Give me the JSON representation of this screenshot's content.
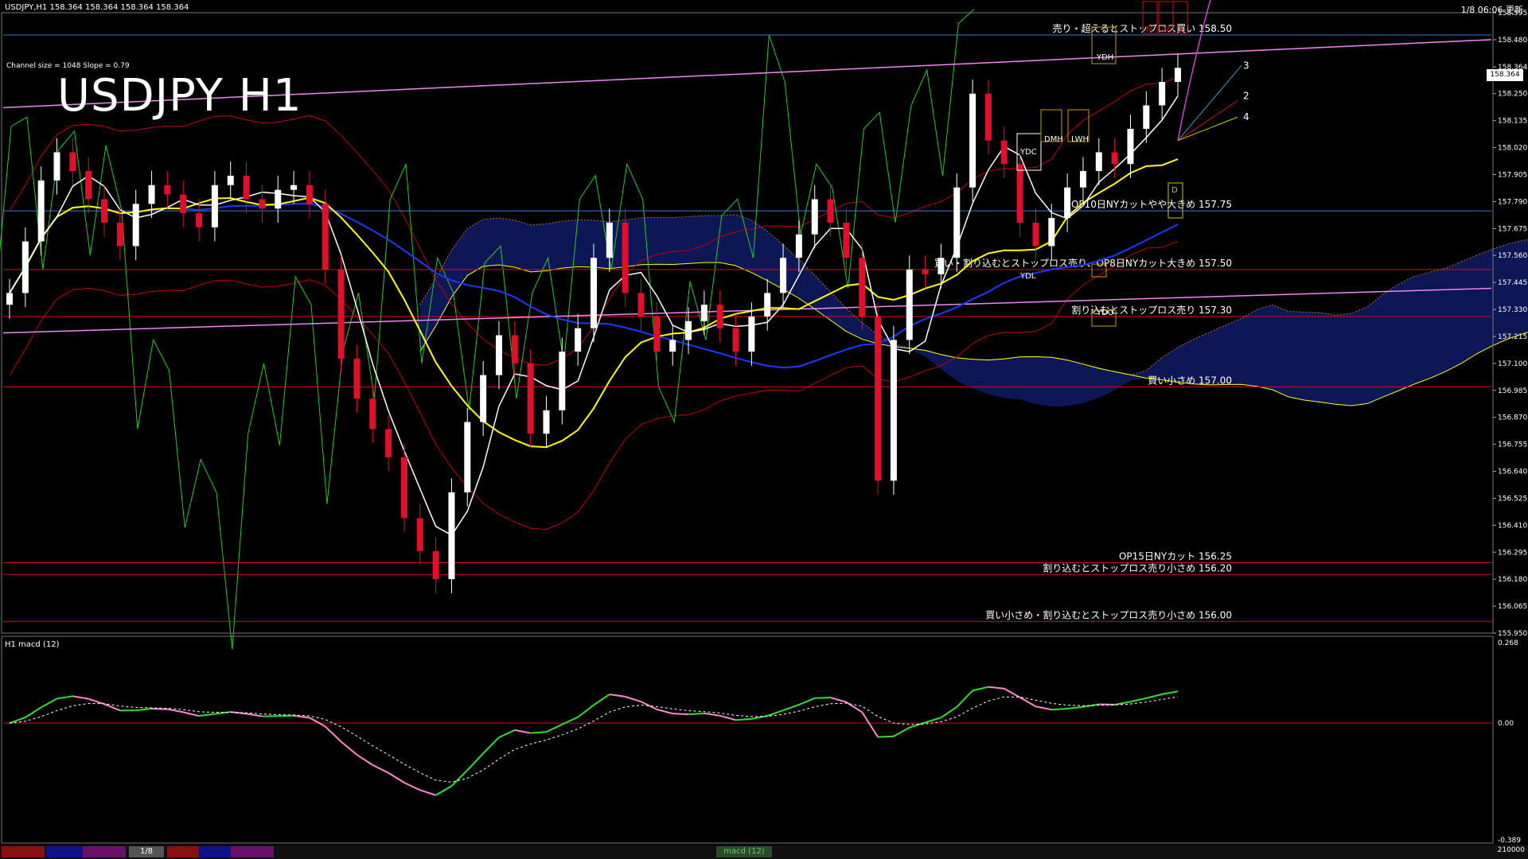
{
  "window": {
    "symbol_line": "USDJPY,H1  158.364 158.364 158.364 158.364",
    "clock": "1/8 06:06 更新"
  },
  "title": "USDJPY H1",
  "channel_info": "Channel size = 1048 Slope = 0.79",
  "macd_title": "H1  macd (12)",
  "current_price": "158.364",
  "colors": {
    "bg": "#000000",
    "bull": "#ffffff",
    "bear": "#e0102a",
    "ma_fast": "#ffffff",
    "ma_mid": "#ffff00",
    "ma_slow": "#1a3aff",
    "bollinger": "#c00000",
    "chikou": "#22cc22",
    "cloud_blue": "#1a2a9a",
    "cloud_orange": "#b07040",
    "level_red": "#d01010",
    "level_blue": "#3a7acd",
    "trend_pink": "#ee88ee",
    "macd_up": "#33dd33",
    "macd_down": "#ff88cc"
  },
  "chart_data": {
    "type": "candlestick",
    "ylim": [
      155.95,
      158.595
    ],
    "y_ticks": [
      "158.595",
      "158.480",
      "158.364",
      "158.250",
      "158.135",
      "158.020",
      "157.905",
      "157.790",
      "157.675",
      "157.560",
      "157.445",
      "157.330",
      "157.215",
      "157.100",
      "156.985",
      "156.870",
      "156.755",
      "156.640",
      "156.525",
      "156.410",
      "156.295",
      "156.180",
      "156.065",
      "155.950"
    ],
    "closes": [
      157.4,
      157.62,
      157.88,
      158.0,
      157.92,
      157.8,
      157.7,
      157.6,
      157.78,
      157.86,
      157.82,
      157.74,
      157.68,
      157.86,
      157.9,
      157.8,
      157.76,
      157.84,
      157.86,
      157.78,
      157.5,
      157.12,
      156.95,
      156.82,
      156.7,
      156.44,
      156.3,
      156.18,
      156.55,
      156.85,
      157.05,
      157.22,
      157.1,
      156.8,
      156.9,
      157.15,
      157.25,
      157.55,
      157.7,
      157.4,
      157.3,
      157.15,
      157.2,
      157.28,
      157.35,
      157.25,
      157.15,
      157.3,
      157.4,
      157.55,
      157.65,
      157.8,
      157.7,
      157.55,
      157.3,
      156.6,
      157.2,
      157.5,
      157.48,
      157.55,
      157.85,
      158.25,
      158.05,
      157.95,
      157.7,
      157.6,
      157.72,
      157.85,
      157.92,
      158.0,
      157.95,
      158.1,
      158.2,
      158.3,
      158.36
    ],
    "macd_ylim": [
      -0.389,
      0.268
    ],
    "macd_ticks": [
      "0.268",
      "0.00",
      "-0.389"
    ],
    "levels": [
      {
        "label": "売り・超えるとストップロス買い 158.50",
        "price": 158.5,
        "color": "#3a7acd"
      },
      {
        "label": "OP10日NYカットやや大きめ 157.75",
        "price": 157.75,
        "color": "#3a7acd"
      },
      {
        "label": "買い・割り込むとストップロス売り、OP8日NYカット大きめ 157.50",
        "price": 157.5,
        "color": "#d01010"
      },
      {
        "label": "割り込むとストップロス売り 157.30",
        "price": 157.3,
        "color": "#d01010"
      },
      {
        "label": "買い小さめ 157.00",
        "price": 157.0,
        "color": "#d01010"
      },
      {
        "label": "OP15日NYカット 156.25",
        "price": 156.25,
        "color": "#d01010"
      },
      {
        "label": "割り込むとストップロス売り小さめ 156.20",
        "price": 156.2,
        "color": "#d01010"
      },
      {
        "label": "買い小さめ・割り込むとストップロス売り小さめ 156.00",
        "price": 156.0,
        "color": "#d01010"
      }
    ],
    "box_labels": [
      "YDH",
      "YDC",
      "LWH",
      "DMH",
      "YDO",
      "YDL",
      "M",
      "W",
      "D",
      "D"
    ],
    "fan_labels": [
      "3",
      "2",
      "4"
    ]
  },
  "bottom_bar": {
    "date_tab": "1/8",
    "macd_tab": "macd (12)",
    "right_text": "210000"
  }
}
